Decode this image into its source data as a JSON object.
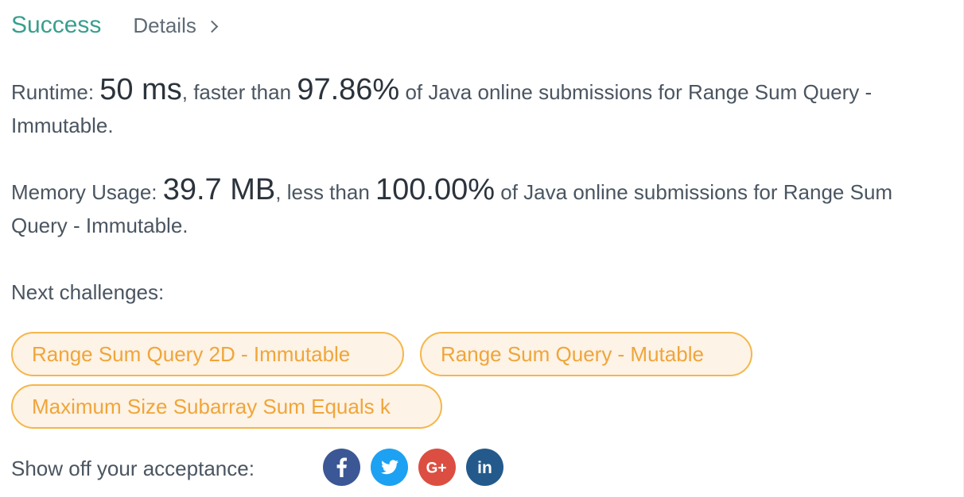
{
  "header": {
    "status": "Success",
    "details_label": "Details"
  },
  "runtime": {
    "label": "Runtime:",
    "value": "50 ms",
    "comparison": ", faster than",
    "percent": "97.86%",
    "suffix": "of Java online submissions for Range Sum Query - Immutable."
  },
  "memory": {
    "label": "Memory Usage:",
    "value": "39.7 MB",
    "comparison": ", less than",
    "percent": "100.00%",
    "suffix": "of Java online submissions for Range Sum Query - Immutable."
  },
  "next": {
    "label": "Next challenges:",
    "challenges": [
      "Range Sum Query 2D - Immutable",
      "Range Sum Query - Mutable",
      "Maximum Size Subarray Sum Equals k"
    ]
  },
  "share": {
    "label": "Show off your acceptance:",
    "icons": [
      "facebook-icon",
      "twitter-icon",
      "google-plus-icon",
      "linkedin-icon"
    ]
  },
  "colors": {
    "success": "#3a9e8f",
    "chip_border": "#f5b64a",
    "chip_text": "#f0a53a",
    "chip_bg": "#fdf3e6",
    "facebook": "#3b5795",
    "twitter": "#1da1f2",
    "google_plus": "#dc4e41",
    "linkedin": "#235a8b"
  }
}
